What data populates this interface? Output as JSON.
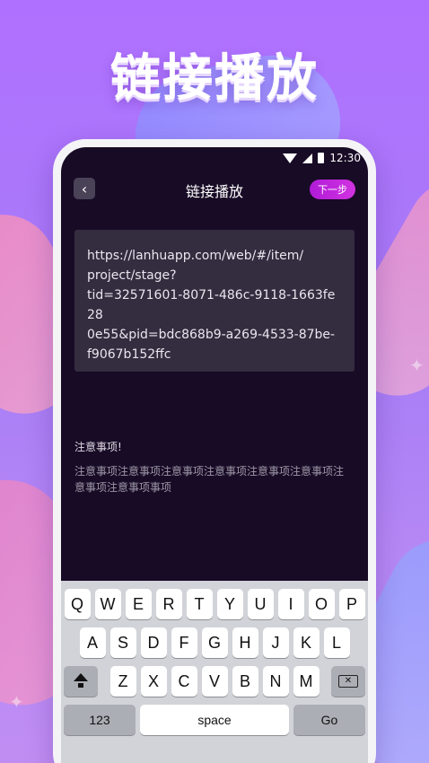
{
  "headline": "链接播放",
  "status": {
    "time": "12:30"
  },
  "nav": {
    "back_symbol": "‹",
    "title": "链接播放",
    "next_label": "下一步"
  },
  "url_box": {
    "lines": [
      "https://lanhuapp.com/web/#/item/",
      "project/stage?",
      "tid=32571601-8071-486c-9118-1663fe28",
      "0e55&pid=bdc868b9-a269-4533-87be-",
      "f9067b152ffc"
    ]
  },
  "notice": {
    "title": "注意事项!",
    "body": "注意事项注意事项注意事项注意事项注意事项注意事项注意事项注意事项事项"
  },
  "keyboard": {
    "row1": [
      "Q",
      "W",
      "E",
      "R",
      "T",
      "Y",
      "U",
      "I",
      "O",
      "P"
    ],
    "row2": [
      "A",
      "S",
      "D",
      "F",
      "G",
      "H",
      "J",
      "K",
      "L"
    ],
    "row3": [
      "Z",
      "X",
      "C",
      "V",
      "B",
      "N",
      "M"
    ],
    "numbers_label": "123",
    "space_label": "space",
    "go_label": "Go"
  }
}
